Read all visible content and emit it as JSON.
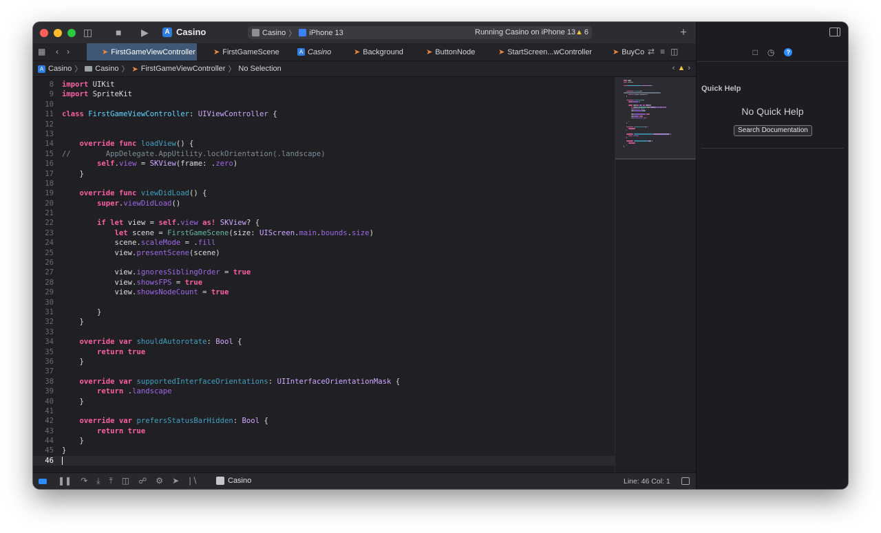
{
  "window": {
    "scheme_name": "Casino",
    "run_destination_scheme": "Casino",
    "run_destination_device": "iPhone 13",
    "activity_status": "Running Casino on iPhone 13",
    "warning_count": "6"
  },
  "tabs": [
    {
      "label": "FirstGameViewController",
      "kind": "swift",
      "active": true
    },
    {
      "label": "FirstGameScene",
      "kind": "swift"
    },
    {
      "label": "Casino",
      "kind": "project"
    },
    {
      "label": "Background",
      "kind": "swift"
    },
    {
      "label": "ButtonNode",
      "kind": "swift"
    },
    {
      "label": "StartScreen...wController",
      "kind": "swift"
    },
    {
      "label": "BuyCo",
      "kind": "swift"
    }
  ],
  "jumpbar": {
    "project": "Casino",
    "folder": "Casino",
    "file": "FirstGameViewController",
    "selection": "No Selection"
  },
  "inspector": {
    "title": "Quick Help",
    "empty_message": "No Quick Help",
    "search_button": "Search Documentation"
  },
  "code": [
    {
      "n": "8",
      "tokens": [
        [
          "kw",
          "import"
        ],
        [
          "plain",
          " UIKit"
        ]
      ]
    },
    {
      "n": "9",
      "tokens": [
        [
          "kw",
          "import"
        ],
        [
          "plain",
          " SpriteKit"
        ]
      ]
    },
    {
      "n": "10",
      "tokens": []
    },
    {
      "n": "11",
      "tokens": [
        [
          "kw",
          "class"
        ],
        [
          "plain",
          " "
        ],
        [
          "cls",
          "FirstGameViewController"
        ],
        [
          "plain",
          ": "
        ],
        [
          "type",
          "UIViewController"
        ],
        [
          "plain",
          " {"
        ]
      ]
    },
    {
      "n": "12",
      "tokens": []
    },
    {
      "n": "13",
      "tokens": []
    },
    {
      "n": "14",
      "tokens": [
        [
          "plain",
          "    "
        ],
        [
          "kw",
          "override func"
        ],
        [
          "plain",
          " "
        ],
        [
          "ident",
          "loadView"
        ],
        [
          "plain",
          "() {"
        ]
      ]
    },
    {
      "n": "15",
      "tokens": [
        [
          "comm",
          "//        AppDelegate.AppUtility.lockOrientation(.landscape)"
        ]
      ]
    },
    {
      "n": "16",
      "tokens": [
        [
          "plain",
          "        "
        ],
        [
          "kw",
          "self"
        ],
        [
          "plain",
          "."
        ],
        [
          "prop",
          "view"
        ],
        [
          "plain",
          " = "
        ],
        [
          "type",
          "SKView"
        ],
        [
          "plain",
          "(frame: ."
        ],
        [
          "prop",
          "zero"
        ],
        [
          "plain",
          ")"
        ]
      ]
    },
    {
      "n": "17",
      "tokens": [
        [
          "plain",
          "    }"
        ]
      ]
    },
    {
      "n": "18",
      "tokens": []
    },
    {
      "n": "19",
      "tokens": [
        [
          "plain",
          "    "
        ],
        [
          "kw",
          "override func"
        ],
        [
          "plain",
          " "
        ],
        [
          "ident",
          "viewDidLoad"
        ],
        [
          "plain",
          "() {"
        ]
      ]
    },
    {
      "n": "20",
      "tokens": [
        [
          "plain",
          "        "
        ],
        [
          "kw",
          "super"
        ],
        [
          "plain",
          "."
        ],
        [
          "prop",
          "viewDidLoad"
        ],
        [
          "plain",
          "()"
        ]
      ]
    },
    {
      "n": "21",
      "tokens": []
    },
    {
      "n": "22",
      "tokens": [
        [
          "plain",
          "        "
        ],
        [
          "kw",
          "if let"
        ],
        [
          "plain",
          " view = "
        ],
        [
          "kw",
          "self"
        ],
        [
          "plain",
          "."
        ],
        [
          "prop",
          "view"
        ],
        [
          "plain",
          " "
        ],
        [
          "kw",
          "as!"
        ],
        [
          "plain",
          " "
        ],
        [
          "type",
          "SKView"
        ],
        [
          "plain",
          "? {"
        ]
      ]
    },
    {
      "n": "23",
      "tokens": [
        [
          "plain",
          "            "
        ],
        [
          "kw",
          "let"
        ],
        [
          "plain",
          " scene = "
        ],
        [
          "func",
          "FirstGameScene"
        ],
        [
          "plain",
          "(size: "
        ],
        [
          "type",
          "UIScreen"
        ],
        [
          "plain",
          "."
        ],
        [
          "prop",
          "main"
        ],
        [
          "plain",
          "."
        ],
        [
          "prop",
          "bounds"
        ],
        [
          "plain",
          "."
        ],
        [
          "prop",
          "size"
        ],
        [
          "plain",
          ")"
        ]
      ]
    },
    {
      "n": "24",
      "tokens": [
        [
          "plain",
          "            scene."
        ],
        [
          "prop",
          "scaleMode"
        ],
        [
          "plain",
          " = ."
        ],
        [
          "prop",
          "fill"
        ]
      ]
    },
    {
      "n": "25",
      "tokens": [
        [
          "plain",
          "            view."
        ],
        [
          "prop",
          "presentScene"
        ],
        [
          "plain",
          "(scene)"
        ]
      ]
    },
    {
      "n": "26",
      "tokens": []
    },
    {
      "n": "27",
      "tokens": [
        [
          "plain",
          "            view."
        ],
        [
          "prop",
          "ignoresSiblingOrder"
        ],
        [
          "plain",
          " = "
        ],
        [
          "kw",
          "true"
        ]
      ]
    },
    {
      "n": "28",
      "tokens": [
        [
          "plain",
          "            view."
        ],
        [
          "prop",
          "showsFPS"
        ],
        [
          "plain",
          " = "
        ],
        [
          "kw",
          "true"
        ]
      ]
    },
    {
      "n": "29",
      "tokens": [
        [
          "plain",
          "            view."
        ],
        [
          "prop",
          "showsNodeCount"
        ],
        [
          "plain",
          " = "
        ],
        [
          "kw",
          "true"
        ]
      ]
    },
    {
      "n": "30",
      "tokens": []
    },
    {
      "n": "31",
      "tokens": [
        [
          "plain",
          "        }"
        ]
      ]
    },
    {
      "n": "32",
      "tokens": [
        [
          "plain",
          "    }"
        ]
      ]
    },
    {
      "n": "33",
      "tokens": []
    },
    {
      "n": "34",
      "tokens": [
        [
          "plain",
          "    "
        ],
        [
          "kw",
          "override var"
        ],
        [
          "plain",
          " "
        ],
        [
          "ident",
          "shouldAutorotate"
        ],
        [
          "plain",
          ": "
        ],
        [
          "type",
          "Bool"
        ],
        [
          "plain",
          " {"
        ]
      ]
    },
    {
      "n": "35",
      "tokens": [
        [
          "plain",
          "        "
        ],
        [
          "kw",
          "return true"
        ]
      ]
    },
    {
      "n": "36",
      "tokens": [
        [
          "plain",
          "    }"
        ]
      ]
    },
    {
      "n": "37",
      "tokens": []
    },
    {
      "n": "38",
      "tokens": [
        [
          "plain",
          "    "
        ],
        [
          "kw",
          "override var"
        ],
        [
          "plain",
          " "
        ],
        [
          "ident",
          "supportedInterfaceOrientations"
        ],
        [
          "plain",
          ": "
        ],
        [
          "type",
          "UIInterfaceOrientationMask"
        ],
        [
          "plain",
          " {"
        ]
      ]
    },
    {
      "n": "39",
      "tokens": [
        [
          "plain",
          "        "
        ],
        [
          "kw",
          "return"
        ],
        [
          "plain",
          " ."
        ],
        [
          "prop",
          "landscape"
        ]
      ]
    },
    {
      "n": "40",
      "tokens": [
        [
          "plain",
          "    }"
        ]
      ]
    },
    {
      "n": "41",
      "tokens": []
    },
    {
      "n": "42",
      "tokens": [
        [
          "plain",
          "    "
        ],
        [
          "kw",
          "override var"
        ],
        [
          "plain",
          " "
        ],
        [
          "ident",
          "prefersStatusBarHidden"
        ],
        [
          "plain",
          ": "
        ],
        [
          "type",
          "Bool"
        ],
        [
          "plain",
          " {"
        ]
      ]
    },
    {
      "n": "43",
      "tokens": [
        [
          "plain",
          "        "
        ],
        [
          "kw",
          "return true"
        ]
      ]
    },
    {
      "n": "44",
      "tokens": [
        [
          "plain",
          "    }"
        ]
      ]
    },
    {
      "n": "45",
      "tokens": [
        [
          "plain",
          "}"
        ]
      ]
    },
    {
      "n": "46",
      "tokens": [],
      "current": true
    }
  ],
  "debugbar": {
    "target": "Casino",
    "position": "Line: 46  Col: 1"
  },
  "colors": {
    "keyword": "#fc5fa3",
    "type": "#d0a8ff",
    "declaration": "#41a1c0",
    "property": "#a167e6",
    "comment": "#7f8c98",
    "active_tab": "#3f5876",
    "accent": "#2f8cff"
  },
  "icons": [
    "sidebar-toggle-icon",
    "stop-icon",
    "run-icon",
    "plus-icon",
    "grid-icon",
    "back-icon",
    "forward-icon",
    "swift-file-icon",
    "warning-icon",
    "inspector-toggle-icon",
    "file-inspector-icon",
    "history-icon",
    "quick-help-icon",
    "debug-toggle-icon",
    "pause-icon",
    "step-over-icon",
    "step-into-icon",
    "step-out-icon",
    "memory-graph-icon",
    "view-debugger-icon",
    "environment-icon",
    "location-icon",
    "console-panel-icon"
  ]
}
